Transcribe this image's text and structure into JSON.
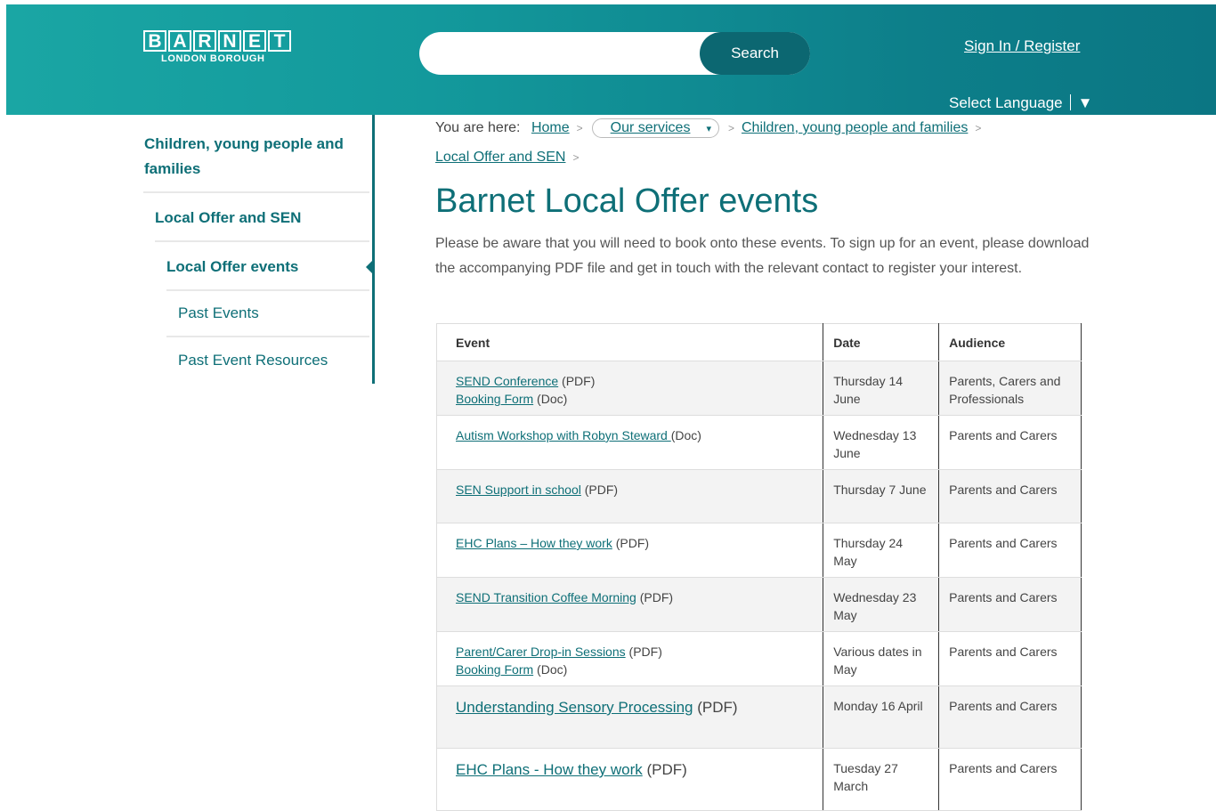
{
  "header": {
    "logo_letters": [
      "B",
      "A",
      "R",
      "N",
      "E",
      "T"
    ],
    "logo_sub": "LONDON BOROUGH",
    "search_button": "Search",
    "search_placeholder": "",
    "signin": "Sign In / Register",
    "language": "Select Language",
    "language_arrow": "▼"
  },
  "sidebar": {
    "section": "Children, young people and families",
    "level1": "Local Offer and SEN",
    "level2": "Local Offer events",
    "children": [
      "Past Events",
      "Past Event Resources"
    ]
  },
  "breadcrumb": {
    "prefix": "You are here:",
    "home": "Home",
    "services": "Our services",
    "services_caret": "▾",
    "children": "Children, young people and families",
    "local": "Local Offer and SEN",
    "separator": ">"
  },
  "page": {
    "title": "Barnet Local Offer events",
    "intro": "Please be aware that you will need to book onto these events. To sign up for an event, please download the accompanying PDF file and get in touch with the relevant contact to register your interest."
  },
  "table": {
    "headers": [
      "Event",
      "Date",
      "Audience"
    ],
    "rows": [
      {
        "link": "SEND Conference",
        "type": " (PDF)",
        "link2": "Booking Form",
        "type2": " (Doc)",
        "date": "Thursday 14 June",
        "audience": "Parents, Carers and Professionals"
      },
      {
        "link": "Autism Workshop with Robyn Steward ",
        "type": "(Doc)",
        "date": "Wednesday 13 June",
        "audience": "Parents and Carers"
      },
      {
        "link": "SEN Support in school",
        "type": " (PDF)",
        "date": "Thursday 7 June",
        "audience": "Parents and Carers"
      },
      {
        "link": "EHC Plans – How they work",
        "type": " (PDF)",
        "date": "Thursday 24 May",
        "audience": "Parents and Carers"
      },
      {
        "link": "SEND Transition Coffee Morning",
        "type": " (PDF)",
        "date": "Wednesday 23 May",
        "audience": "Parents and Carers"
      },
      {
        "link": "Parent/Carer Drop-in Sessions",
        "type": " (PDF)",
        "link2": "Booking Form",
        "type2": " (Doc)",
        "date": "Various dates in May",
        "audience": "Parents and Carers"
      },
      {
        "link": "Understanding Sensory Processing",
        "type": " (PDF)",
        "date": "Monday 16 April",
        "audience": "Parents and Carers"
      },
      {
        "link": "EHC Plans - How they work",
        "type": " (PDF)",
        "date": "Tuesday 27 March",
        "audience": "Parents and Carers"
      }
    ]
  }
}
